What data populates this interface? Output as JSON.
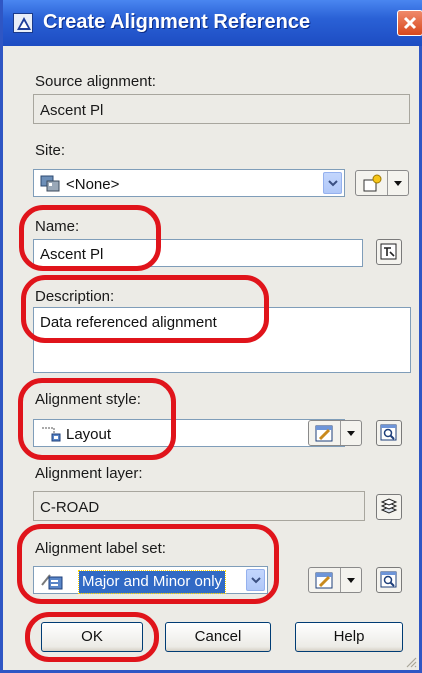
{
  "dialog": {
    "title": "Create Alignment Reference",
    "title_icon": "autocad-app-icon",
    "close_icon": "close-icon"
  },
  "source": {
    "label": "Source alignment:",
    "value": "Ascent Pl"
  },
  "site": {
    "label": "Site:",
    "value": "<None>",
    "icon": "site-icon",
    "create_icon": "new-site-icon"
  },
  "name": {
    "label": "Name:",
    "value": "Ascent Pl",
    "button_icon": "name-template-icon"
  },
  "description": {
    "label": "Description:",
    "value": "Data referenced alignment"
  },
  "alignment_style": {
    "label": "Alignment style:",
    "value": "Layout",
    "icon": "layout-style-icon",
    "edit_icon": "edit-style-icon",
    "preview_icon": "pick-style-icon"
  },
  "alignment_layer": {
    "label": "Alignment layer:",
    "value": "C-ROAD",
    "button_icon": "layers-icon"
  },
  "label_set": {
    "label": "Alignment label set:",
    "value": "Major and Minor only",
    "icon": "label-set-icon",
    "edit_icon": "edit-label-set-icon",
    "preview_icon": "pick-label-set-icon"
  },
  "buttons": {
    "ok": "OK",
    "cancel": "Cancel",
    "help": "Help"
  },
  "colors": {
    "titlebar": "#2a61d6",
    "dialog_bg": "#ecebe6",
    "highlight_ring": "#e0141b",
    "selection": "#316ac5"
  }
}
